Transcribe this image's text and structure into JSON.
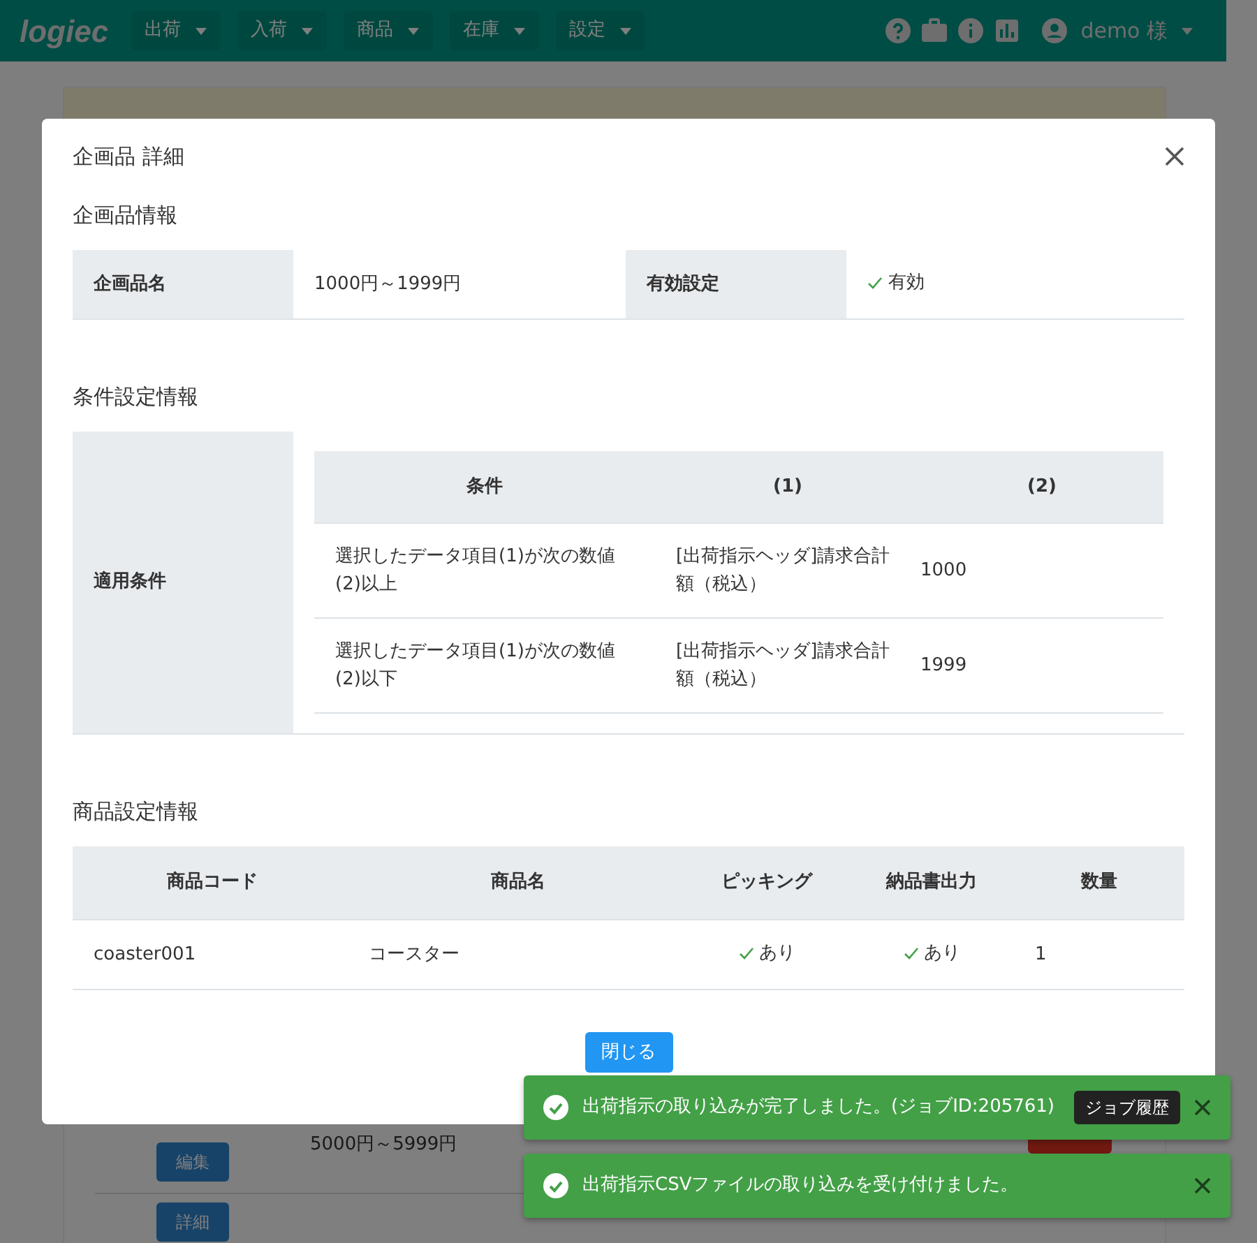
{
  "navbar": {
    "logo": "logiec",
    "menus": [
      {
        "label": "出荷"
      },
      {
        "label": "入荷"
      },
      {
        "label": "商品"
      },
      {
        "label": "在庫"
      },
      {
        "label": "設定"
      }
    ],
    "user": "demo 様"
  },
  "background": {
    "price": "5000円～5999円",
    "edit_button": "編集",
    "detail_button": "詳細"
  },
  "modal": {
    "title": "企画品 詳細",
    "info": {
      "heading": "企画品情報",
      "name_label": "企画品名",
      "name_value": "1000円～1999円",
      "status_label": "有効設定",
      "status_value": "有効",
      "enabled": true
    },
    "conditions": {
      "heading": "条件設定情報",
      "label": "適用条件",
      "columns": [
        "条件",
        "(1)",
        "(2)"
      ],
      "rows": [
        [
          "選択したデータ項目(1)が次の数値(2)以上",
          "[出荷指示ヘッダ]請求合計額（税込）",
          "1000"
        ],
        [
          "選択したデータ項目(1)が次の数値(2)以下",
          "[出荷指示ヘッダ]請求合計額（税込）",
          "1999"
        ]
      ]
    },
    "products": {
      "heading": "商品設定情報",
      "columns": [
        "商品コード",
        "商品名",
        "ピッキング",
        "納品書出力",
        "数量"
      ],
      "rows": [
        {
          "code": "coaster001",
          "name": "コースター",
          "picking": "あり",
          "picking_on": true,
          "slip": "あり",
          "slip_on": true,
          "quantity": "1"
        }
      ]
    },
    "close_button": "閉じる"
  },
  "toasts": [
    {
      "message": "出荷指示の取り込みが完了しました。(ジョブID:205761)",
      "action": "ジョブ履歴"
    },
    {
      "message": "出荷指示CSVファイルの取り込みを受け付けました。"
    }
  ]
}
